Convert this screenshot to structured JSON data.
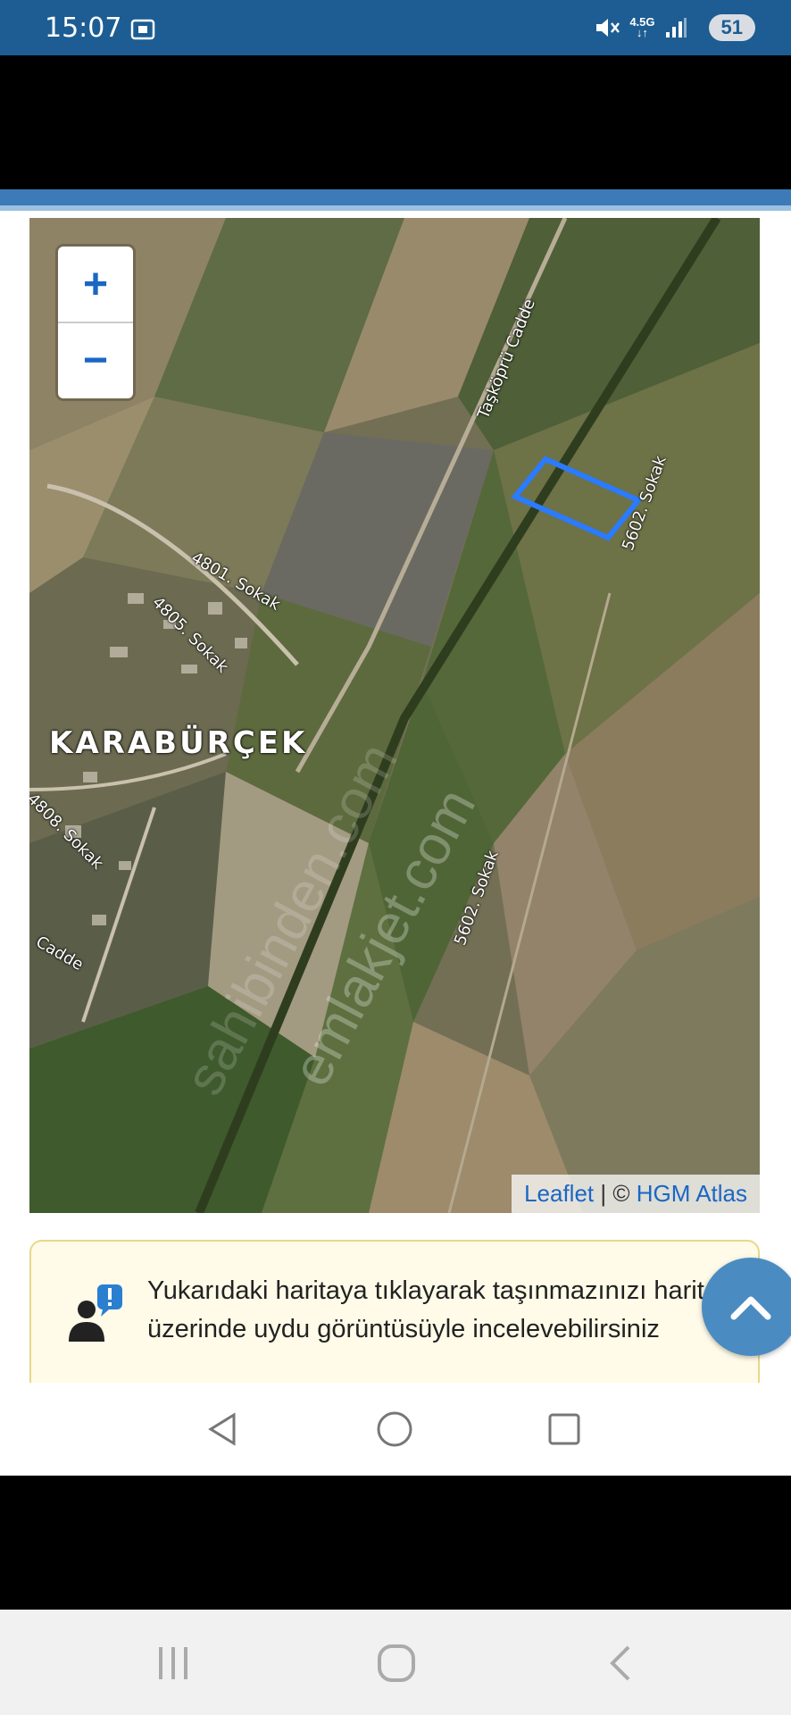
{
  "status_bar": {
    "time": "15:07",
    "network_top": "4.5G",
    "network_bottom": "↓↑",
    "battery": "51",
    "background_color": "#1d5d93"
  },
  "map": {
    "place_label": "KARABÜRÇEK",
    "streets": [
      {
        "name": "Taşköprü Cadde"
      },
      {
        "name": "4801. Sokak"
      },
      {
        "name": "4805. Sokak"
      },
      {
        "name": "5602. Sokak"
      },
      {
        "name": "5602. Sokak"
      },
      {
        "name": "4808. Sokak"
      },
      {
        "name": "Cadde"
      }
    ],
    "zoom_in_label": "+",
    "zoom_out_label": "−",
    "attribution_leaflet": "Leaflet",
    "attribution_separator": " | © ",
    "attribution_provider": "HGM Atlas",
    "watermarks": [
      "emlakjet.com",
      "sahibinden.com"
    ],
    "parcel_outline_color": "#2a7bff"
  },
  "info_box": {
    "text": "Yukarıdaki haritaya tıklayarak taşınmazınızı harita üzerinde uydu görüntüsüyle incelevebilirsiniz"
  },
  "icons": {
    "screenshot": "screenshot-icon",
    "mute": "mute-icon",
    "signal": "signal-icon",
    "user_info": "user-info-icon",
    "scroll_top": "chevron-up-icon",
    "back": "back-icon",
    "home": "home-icon",
    "recents": "recents-icon"
  }
}
